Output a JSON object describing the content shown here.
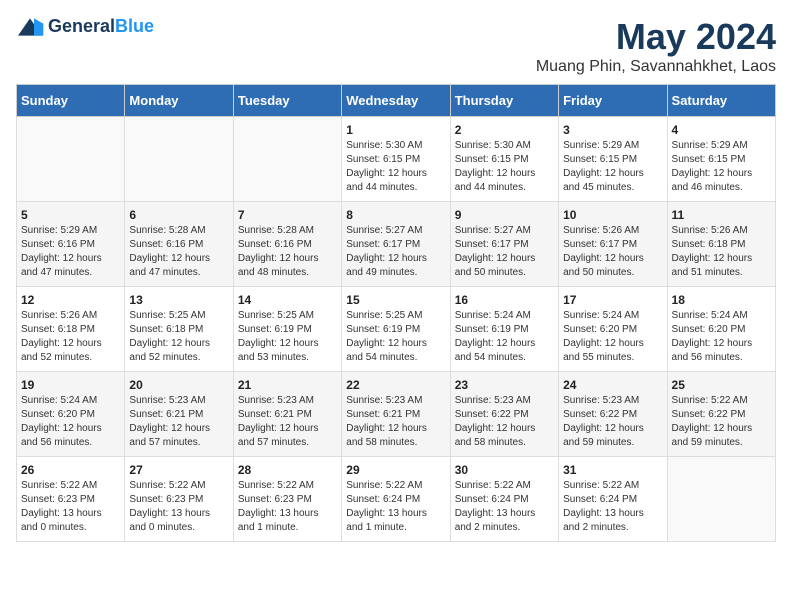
{
  "logo": {
    "general": "General",
    "blue": "Blue"
  },
  "title": "May 2024",
  "subtitle": "Muang Phin, Savannahkhet, Laos",
  "weekdays": [
    "Sunday",
    "Monday",
    "Tuesday",
    "Wednesday",
    "Thursday",
    "Friday",
    "Saturday"
  ],
  "weeks": [
    [
      {
        "day": "",
        "sunrise": "",
        "sunset": "",
        "daylight": ""
      },
      {
        "day": "",
        "sunrise": "",
        "sunset": "",
        "daylight": ""
      },
      {
        "day": "",
        "sunrise": "",
        "sunset": "",
        "daylight": ""
      },
      {
        "day": "1",
        "sunrise": "Sunrise: 5:30 AM",
        "sunset": "Sunset: 6:15 PM",
        "daylight": "Daylight: 12 hours and 44 minutes."
      },
      {
        "day": "2",
        "sunrise": "Sunrise: 5:30 AM",
        "sunset": "Sunset: 6:15 PM",
        "daylight": "Daylight: 12 hours and 44 minutes."
      },
      {
        "day": "3",
        "sunrise": "Sunrise: 5:29 AM",
        "sunset": "Sunset: 6:15 PM",
        "daylight": "Daylight: 12 hours and 45 minutes."
      },
      {
        "day": "4",
        "sunrise": "Sunrise: 5:29 AM",
        "sunset": "Sunset: 6:15 PM",
        "daylight": "Daylight: 12 hours and 46 minutes."
      }
    ],
    [
      {
        "day": "5",
        "sunrise": "Sunrise: 5:29 AM",
        "sunset": "Sunset: 6:16 PM",
        "daylight": "Daylight: 12 hours and 47 minutes."
      },
      {
        "day": "6",
        "sunrise": "Sunrise: 5:28 AM",
        "sunset": "Sunset: 6:16 PM",
        "daylight": "Daylight: 12 hours and 47 minutes."
      },
      {
        "day": "7",
        "sunrise": "Sunrise: 5:28 AM",
        "sunset": "Sunset: 6:16 PM",
        "daylight": "Daylight: 12 hours and 48 minutes."
      },
      {
        "day": "8",
        "sunrise": "Sunrise: 5:27 AM",
        "sunset": "Sunset: 6:17 PM",
        "daylight": "Daylight: 12 hours and 49 minutes."
      },
      {
        "day": "9",
        "sunrise": "Sunrise: 5:27 AM",
        "sunset": "Sunset: 6:17 PM",
        "daylight": "Daylight: 12 hours and 50 minutes."
      },
      {
        "day": "10",
        "sunrise": "Sunrise: 5:26 AM",
        "sunset": "Sunset: 6:17 PM",
        "daylight": "Daylight: 12 hours and 50 minutes."
      },
      {
        "day": "11",
        "sunrise": "Sunrise: 5:26 AM",
        "sunset": "Sunset: 6:18 PM",
        "daylight": "Daylight: 12 hours and 51 minutes."
      }
    ],
    [
      {
        "day": "12",
        "sunrise": "Sunrise: 5:26 AM",
        "sunset": "Sunset: 6:18 PM",
        "daylight": "Daylight: 12 hours and 52 minutes."
      },
      {
        "day": "13",
        "sunrise": "Sunrise: 5:25 AM",
        "sunset": "Sunset: 6:18 PM",
        "daylight": "Daylight: 12 hours and 52 minutes."
      },
      {
        "day": "14",
        "sunrise": "Sunrise: 5:25 AM",
        "sunset": "Sunset: 6:19 PM",
        "daylight": "Daylight: 12 hours and 53 minutes."
      },
      {
        "day": "15",
        "sunrise": "Sunrise: 5:25 AM",
        "sunset": "Sunset: 6:19 PM",
        "daylight": "Daylight: 12 hours and 54 minutes."
      },
      {
        "day": "16",
        "sunrise": "Sunrise: 5:24 AM",
        "sunset": "Sunset: 6:19 PM",
        "daylight": "Daylight: 12 hours and 54 minutes."
      },
      {
        "day": "17",
        "sunrise": "Sunrise: 5:24 AM",
        "sunset": "Sunset: 6:20 PM",
        "daylight": "Daylight: 12 hours and 55 minutes."
      },
      {
        "day": "18",
        "sunrise": "Sunrise: 5:24 AM",
        "sunset": "Sunset: 6:20 PM",
        "daylight": "Daylight: 12 hours and 56 minutes."
      }
    ],
    [
      {
        "day": "19",
        "sunrise": "Sunrise: 5:24 AM",
        "sunset": "Sunset: 6:20 PM",
        "daylight": "Daylight: 12 hours and 56 minutes."
      },
      {
        "day": "20",
        "sunrise": "Sunrise: 5:23 AM",
        "sunset": "Sunset: 6:21 PM",
        "daylight": "Daylight: 12 hours and 57 minutes."
      },
      {
        "day": "21",
        "sunrise": "Sunrise: 5:23 AM",
        "sunset": "Sunset: 6:21 PM",
        "daylight": "Daylight: 12 hours and 57 minutes."
      },
      {
        "day": "22",
        "sunrise": "Sunrise: 5:23 AM",
        "sunset": "Sunset: 6:21 PM",
        "daylight": "Daylight: 12 hours and 58 minutes."
      },
      {
        "day": "23",
        "sunrise": "Sunrise: 5:23 AM",
        "sunset": "Sunset: 6:22 PM",
        "daylight": "Daylight: 12 hours and 58 minutes."
      },
      {
        "day": "24",
        "sunrise": "Sunrise: 5:23 AM",
        "sunset": "Sunset: 6:22 PM",
        "daylight": "Daylight: 12 hours and 59 minutes."
      },
      {
        "day": "25",
        "sunrise": "Sunrise: 5:22 AM",
        "sunset": "Sunset: 6:22 PM",
        "daylight": "Daylight: 12 hours and 59 minutes."
      }
    ],
    [
      {
        "day": "26",
        "sunrise": "Sunrise: 5:22 AM",
        "sunset": "Sunset: 6:23 PM",
        "daylight": "Daylight: 13 hours and 0 minutes."
      },
      {
        "day": "27",
        "sunrise": "Sunrise: 5:22 AM",
        "sunset": "Sunset: 6:23 PM",
        "daylight": "Daylight: 13 hours and 0 minutes."
      },
      {
        "day": "28",
        "sunrise": "Sunrise: 5:22 AM",
        "sunset": "Sunset: 6:23 PM",
        "daylight": "Daylight: 13 hours and 1 minute."
      },
      {
        "day": "29",
        "sunrise": "Sunrise: 5:22 AM",
        "sunset": "Sunset: 6:24 PM",
        "daylight": "Daylight: 13 hours and 1 minute."
      },
      {
        "day": "30",
        "sunrise": "Sunrise: 5:22 AM",
        "sunset": "Sunset: 6:24 PM",
        "daylight": "Daylight: 13 hours and 2 minutes."
      },
      {
        "day": "31",
        "sunrise": "Sunrise: 5:22 AM",
        "sunset": "Sunset: 6:24 PM",
        "daylight": "Daylight: 13 hours and 2 minutes."
      },
      {
        "day": "",
        "sunrise": "",
        "sunset": "",
        "daylight": ""
      }
    ]
  ]
}
